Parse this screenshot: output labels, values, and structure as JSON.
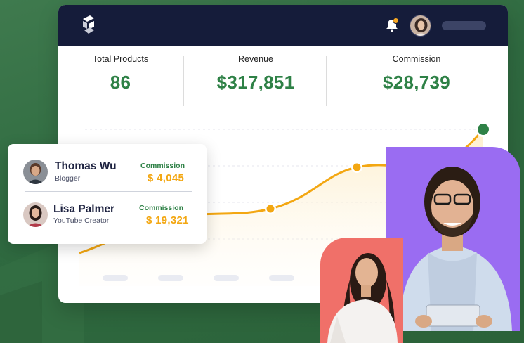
{
  "stats": [
    {
      "label": "Total Products",
      "value": "86"
    },
    {
      "label": "Revenue",
      "value": "$317,851"
    },
    {
      "label": "Commission",
      "value": "$28,739"
    }
  ],
  "affiliates": [
    {
      "name": "Thomas Wu",
      "role": "Blogger",
      "commission_label": "Commission",
      "commission_value": "$ 4,045"
    },
    {
      "name": "Lisa Palmer",
      "role": "YouTube Creator",
      "commission_label": "Commission",
      "commission_value": "$ 19,321"
    }
  ],
  "colors": {
    "brand_green": "#2e8146",
    "accent_orange": "#f3a712",
    "navbar": "#151c3a",
    "purple_card": "#9a6cf2",
    "coral_card": "#f07069"
  },
  "icons": [
    "logo-icon",
    "bell-icon",
    "notification-dot",
    "user-avatar"
  ]
}
